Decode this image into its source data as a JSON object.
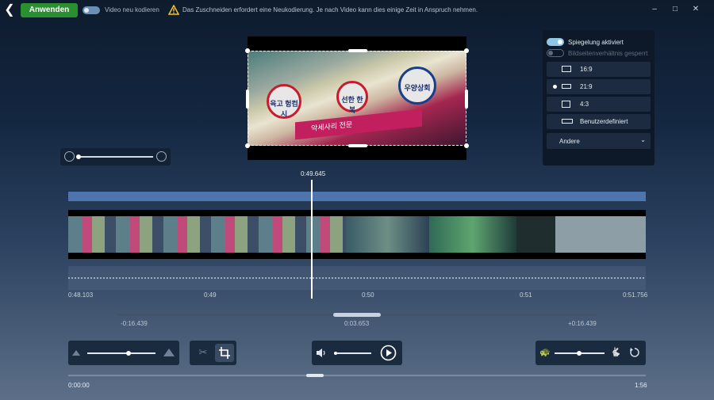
{
  "topbar": {
    "back_icon": "arrow-left-icon",
    "apply_label": "Anwenden",
    "reencode_label": "Video neu kodieren",
    "warning_text": "Das Zuschneiden erfordert eine Neukodierung. Je nach Video kann dies einige Zeit in Anspruch nehmen."
  },
  "window": {
    "minimize": "–",
    "maximize": "□",
    "close": "✕"
  },
  "preview": {
    "sign1_text": "육고 헝컴시",
    "sign2_text": "선한 한복",
    "sign3_text": "우양상회",
    "banner_text": "악세사리 전문"
  },
  "panel": {
    "mirror_label": "Spiegelung aktiviert",
    "aspect_lock_label": "Bildseitenverhältnis gesperrt",
    "options": [
      "16:9",
      "21:9",
      "4:3",
      "Benutzerdefiniert"
    ],
    "selected_option": "21:9",
    "other_label": "Andere"
  },
  "timeline": {
    "current_time": "0:49.645",
    "ticks": [
      "0:48.103",
      "0:49",
      "0:50",
      "0:51",
      "0:51.756"
    ]
  },
  "offset": {
    "left": "-0:16.439",
    "center": "0:03.653",
    "right": "+0:16.439"
  },
  "playback": {
    "start_time": "0:00:00",
    "end_time": "1:56"
  },
  "colors": {
    "accent": "#2a8f2e",
    "track": "#4e75ad"
  }
}
